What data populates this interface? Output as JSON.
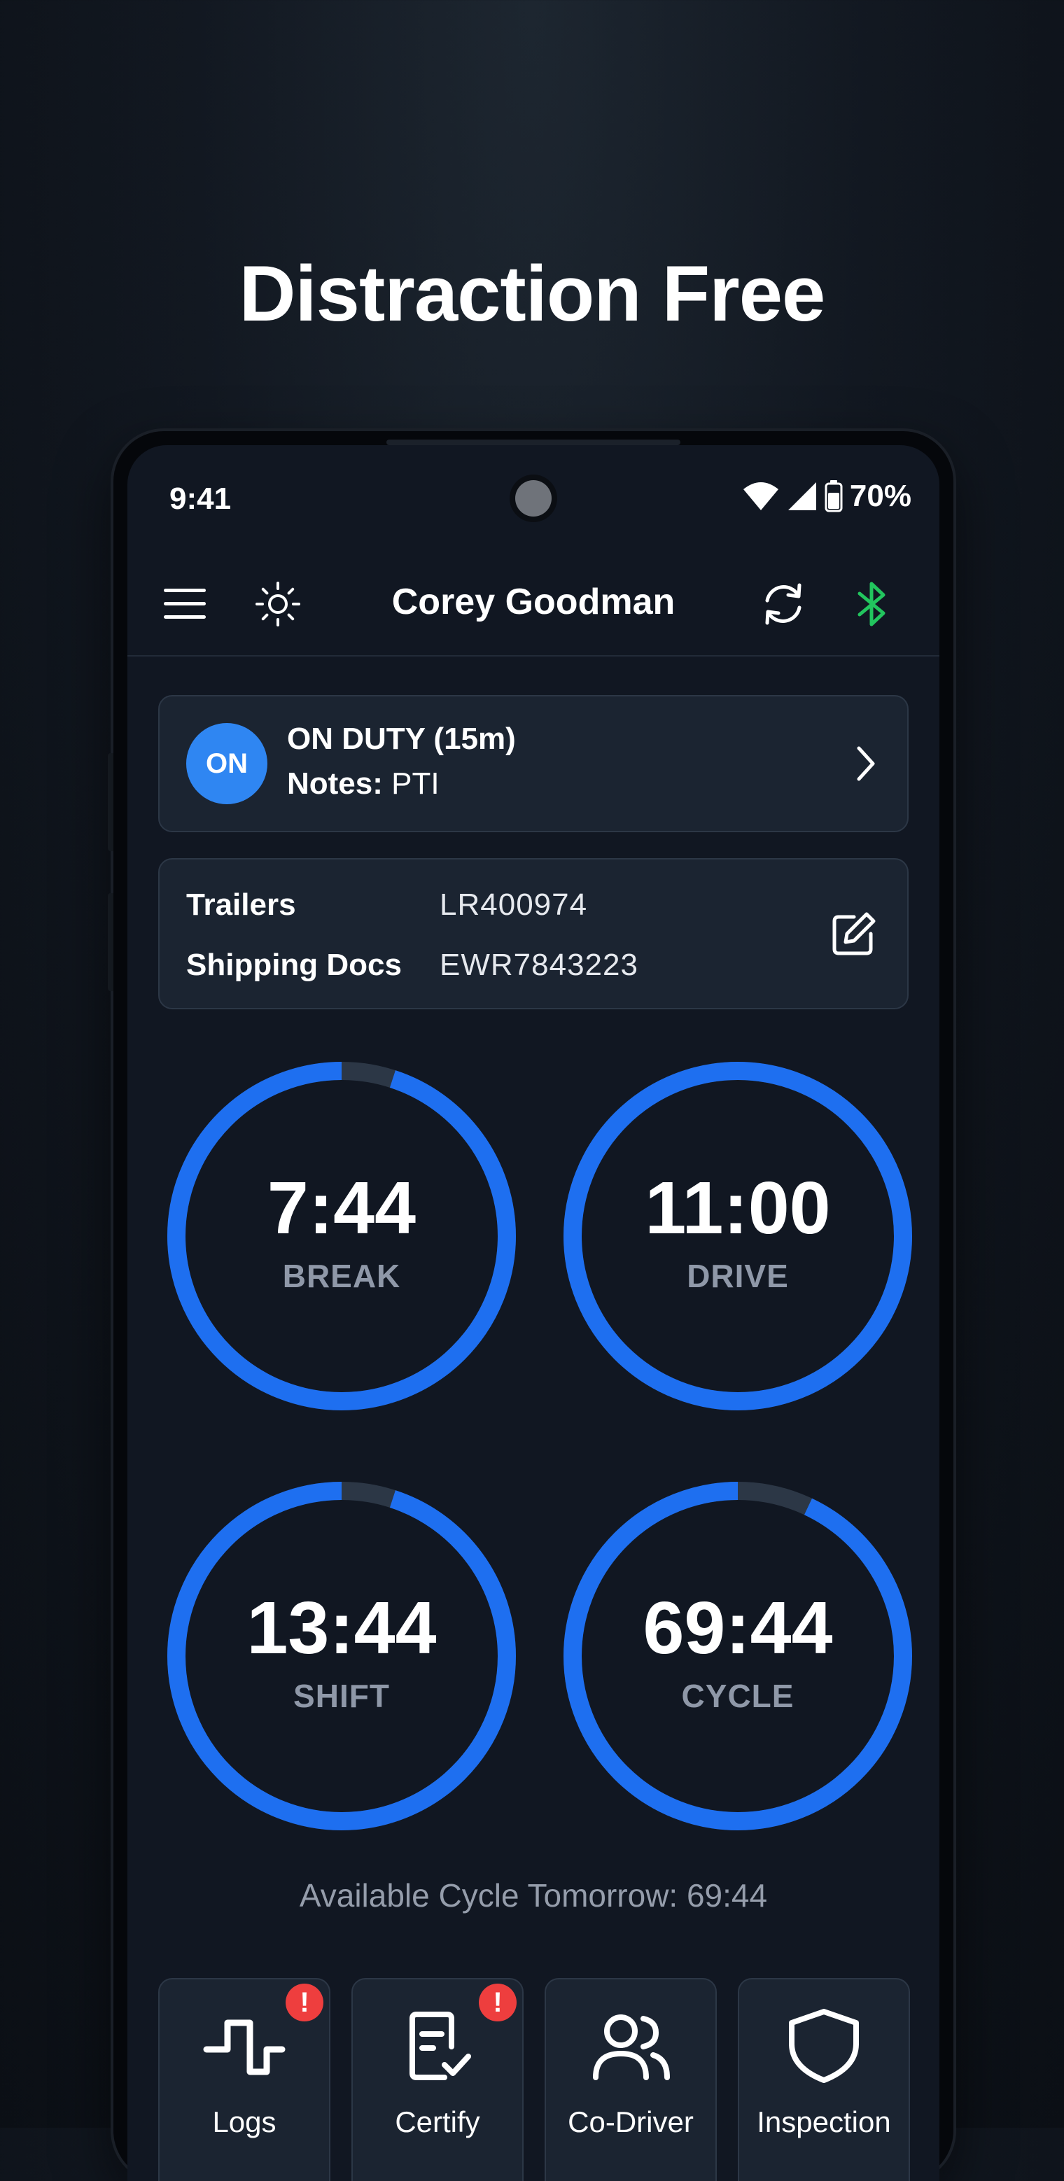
{
  "headline": "Distraction Free",
  "status_bar": {
    "time": "9:41",
    "battery": "70%"
  },
  "app_bar": {
    "title": "Corey Goodman"
  },
  "duty_card": {
    "badge": "ON",
    "title": "ON DUTY (15m)",
    "notes_label": "Notes:",
    "notes_value": "PTI"
  },
  "info_card": {
    "rows": [
      {
        "label": "Trailers",
        "value": "LR400974"
      },
      {
        "label": "Shipping Docs",
        "value": "EWR7843223"
      }
    ]
  },
  "gauges": [
    {
      "value": "7:44",
      "label": "BREAK",
      "fraction": 0.95
    },
    {
      "value": "11:00",
      "label": "DRIVE",
      "fraction": 1.0
    },
    {
      "value": "13:44",
      "label": "SHIFT",
      "fraction": 0.95
    },
    {
      "value": "69:44",
      "label": "CYCLE",
      "fraction": 0.93
    }
  ],
  "available_cycle": "Available Cycle Tomorrow: 69:44",
  "nav": [
    {
      "label": "Logs",
      "icon": "logs-icon",
      "alert": "!"
    },
    {
      "label": "Certify",
      "icon": "certify-icon",
      "alert": "!"
    },
    {
      "label": "Co-Driver",
      "icon": "co-driver-icon"
    },
    {
      "label": "Inspection",
      "icon": "shield-icon"
    }
  ],
  "colors": {
    "accent": "#1e6ff0",
    "track": "#2c3746",
    "duty_badge": "#2f86f2",
    "bluetooth": "#22c55e",
    "alert": "#ee3e3e"
  }
}
